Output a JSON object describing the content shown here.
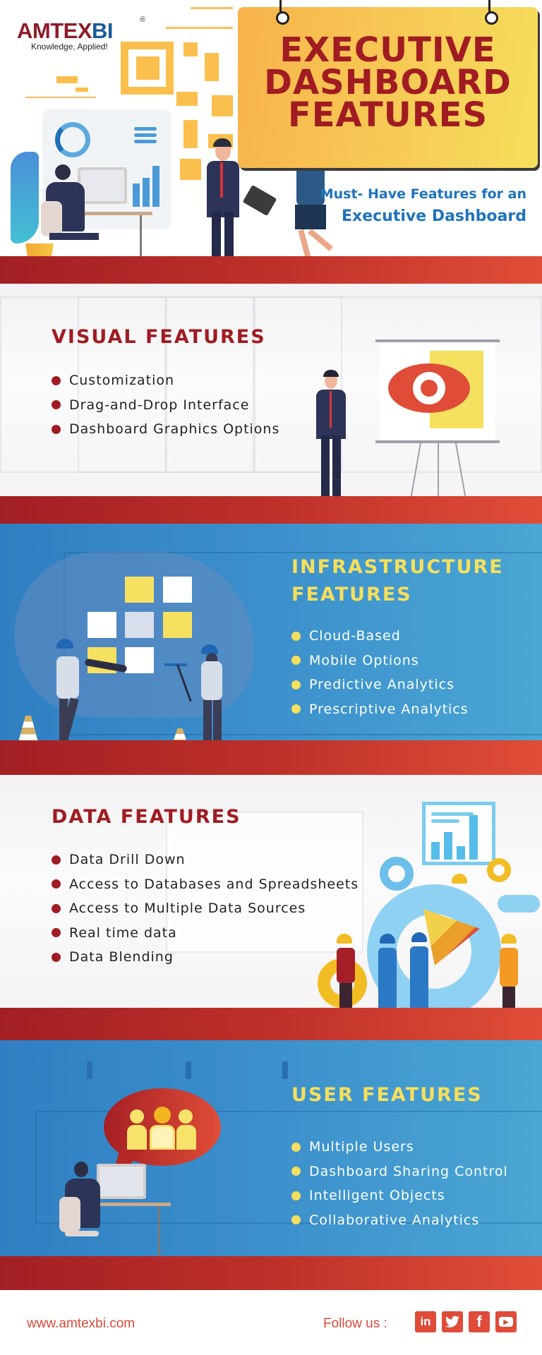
{
  "brand": {
    "logo_part1": "AMTEX",
    "logo_part2": "BI",
    "registered_mark": "®",
    "tagline": "Knowledge, Applied!"
  },
  "hero": {
    "title_line1": "EXECUTIVE",
    "title_line2": "DASHBOARD",
    "title_line3": "FEATURES",
    "subtitle_line1": "Must- Have Features for an",
    "subtitle_line2": "Executive Dashboard"
  },
  "sections": {
    "visual": {
      "title": "VISUAL FEATURES",
      "items": [
        "Customization",
        "Drag-and-Drop Interface",
        "Dashboard Graphics Options"
      ]
    },
    "infrastructure": {
      "title_line1": "INFRASTRUCTURE",
      "title_line2": "FEATURES",
      "items": [
        "Cloud-Based",
        "Mobile Options",
        "Predictive Analytics",
        "Prescriptive Analytics"
      ]
    },
    "data": {
      "title": "DATA FEATURES",
      "items": [
        "Data Drill Down",
        "Access to Databases and Spreadsheets",
        "Access to Multiple Data Sources",
        "Real time data",
        "Data Blending"
      ]
    },
    "user": {
      "title": "USER FEATURES",
      "items": [
        "Multiple Users",
        "Dashboard Sharing Control",
        "Intelligent Objects",
        "Collaborative Analytics"
      ]
    }
  },
  "footer": {
    "website": "www.amtexbi.com",
    "follow_label": "Follow us :",
    "social": [
      {
        "name": "linkedin",
        "glyph": "in"
      },
      {
        "name": "twitter",
        "glyph": "t"
      },
      {
        "name": "facebook",
        "glyph": "f"
      },
      {
        "name": "youtube",
        "glyph": "▶"
      }
    ]
  },
  "colors": {
    "brand_red": "#a01c22",
    "brand_blue": "#1f73bc",
    "accent_yellow": "#f5df5c",
    "floor_red": "#bd3029",
    "section_blue": "#3c90cc",
    "footer_red": "#d84a39"
  }
}
